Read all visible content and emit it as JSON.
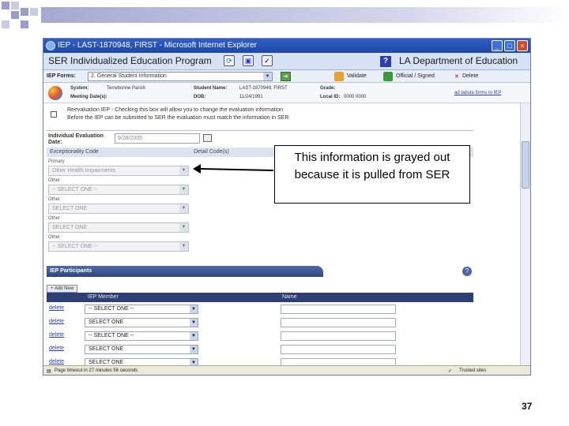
{
  "window": {
    "title": "IEP - LAST-1870948, FIRST - Microsoft Internet Explorer",
    "app_title": "SER Individualized Education Program",
    "org_title": "LA Department of Education"
  },
  "form_bar": {
    "label": "IEP Forms:",
    "selected_form": "2. General Student Information",
    "validate_label": "Validate",
    "official_label": "Official / Signed",
    "delete_label": "Delete"
  },
  "student_info": {
    "system_label": "System:",
    "system_value": "Terrebonne Parish",
    "student_name_label": "Student Name:",
    "student_name_value": "LAST-1870948, FIRST",
    "grade_label": "Grade:",
    "meeting_label": "Meeting Date(s):",
    "dob_label": "DOB:",
    "dob_value": "11/24/1991",
    "local_id_label": "Local ID:",
    "local_id_value": "0000 0000",
    "link_text": "ad tabula forms to IEP"
  },
  "reevaluation": {
    "line1": "Reevaluation IEP - Checking this box will allow you to change the evaluation information",
    "line2": "Before the IEP can be submitted to SER the evaluation must match the information in SER"
  },
  "evaluation": {
    "label": "Individual Evaluation Date:",
    "date": "9/28/2005"
  },
  "exceptionality": {
    "header_code": "Exceptionality Code",
    "header_detail": "Detail Code(s)",
    "fields": [
      {
        "label": "Primary",
        "value": "Other Health Impairments"
      },
      {
        "label": "Other",
        "value": "-- SELECT ONE --"
      },
      {
        "label": "Other",
        "value": "SELECT ONE"
      },
      {
        "label": "Other",
        "value": "SELECT ONE"
      },
      {
        "label": "Other",
        "value": "-- SELECT ONE --"
      }
    ]
  },
  "participants": {
    "header": "IEP Participants",
    "add_new": "Add New",
    "col_member": "IEP Member",
    "col_name": "Name",
    "rows": [
      {
        "delete": "delete",
        "member": "-- SELECT ONE --"
      },
      {
        "delete": "delete",
        "member": "SELECT ONE"
      },
      {
        "delete": "delete",
        "member": "-- SELECT ONE --"
      },
      {
        "delete": "delete",
        "member": "SELECT ONE"
      },
      {
        "delete": "delete",
        "member": "SELECT ONE"
      }
    ]
  },
  "status_bar": {
    "timeout": "Page timeout in 27 minutes 56 seconds",
    "zone": "Trusted sites"
  },
  "callout": {
    "text": "This information is grayed out because it is pulled from SER"
  },
  "page_number": "37"
}
